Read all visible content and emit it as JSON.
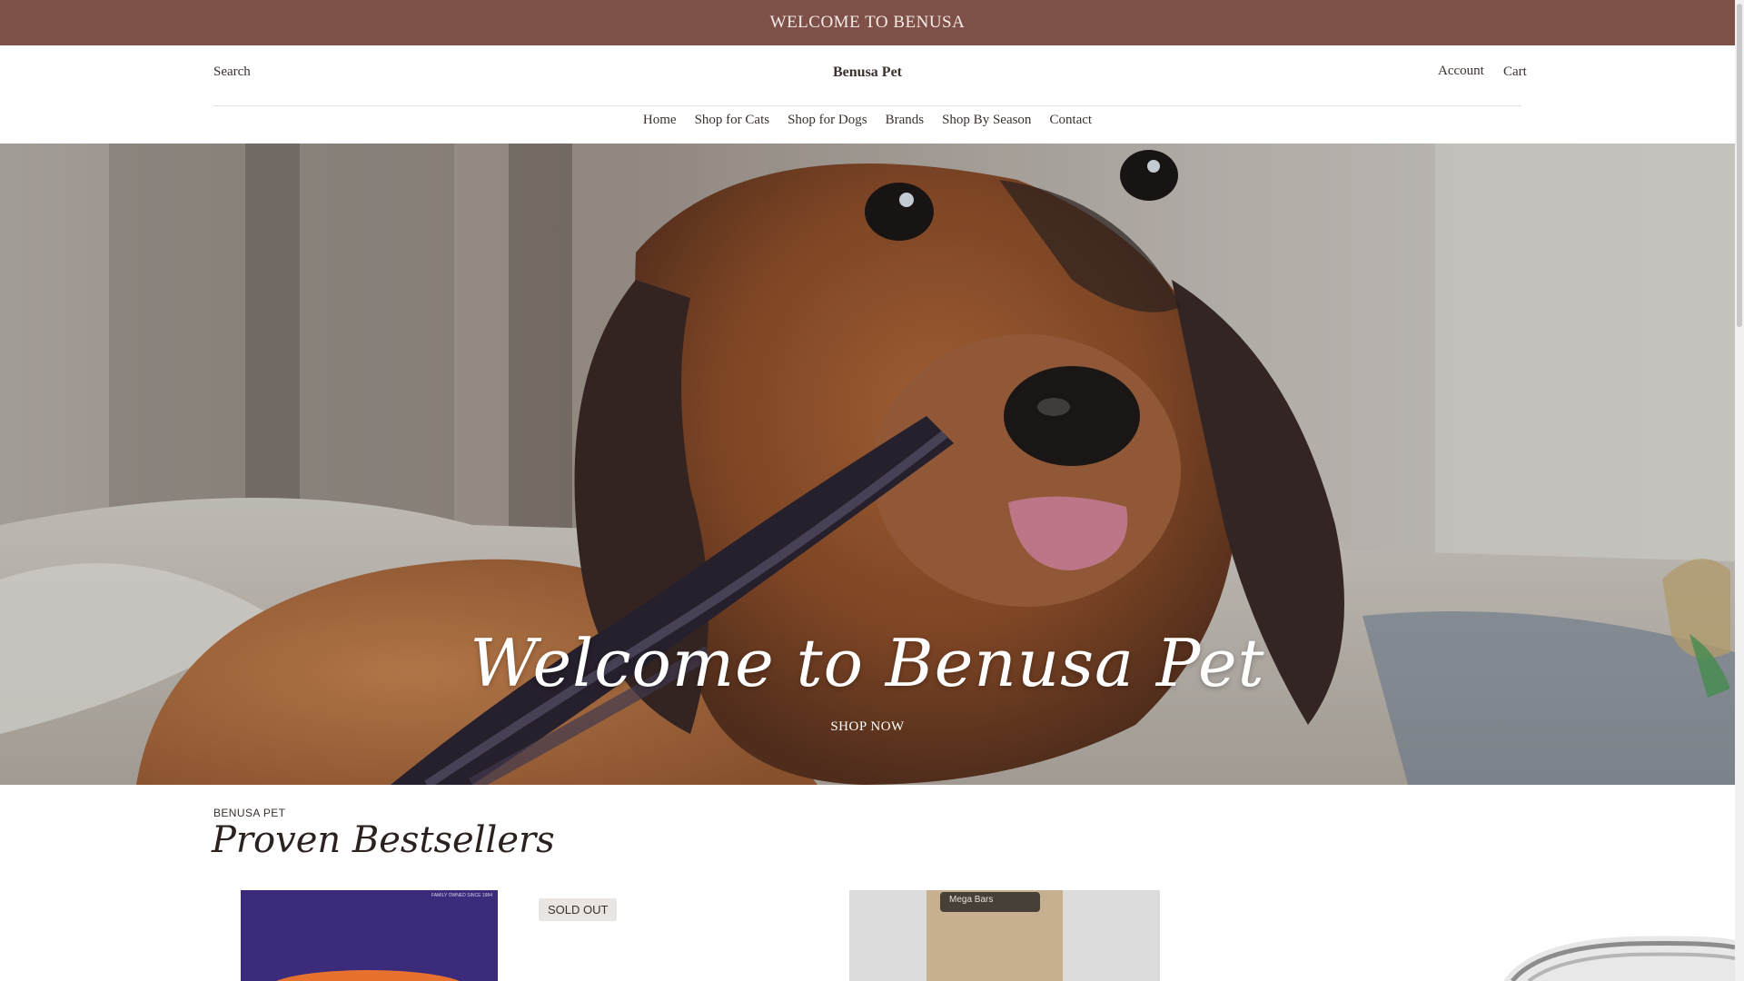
{
  "announcement": {
    "text": "WELCOME TO BENUSA"
  },
  "header": {
    "search_label": "Search",
    "logo": "Benusa Pet",
    "account_label": "Account",
    "cart_label": "Cart"
  },
  "nav": {
    "items": [
      {
        "label": "Home"
      },
      {
        "label": "Shop for Cats"
      },
      {
        "label": "Shop for Dogs"
      },
      {
        "label": "Brands"
      },
      {
        "label": "Shop By Season"
      },
      {
        "label": "Contact"
      }
    ]
  },
  "hero": {
    "title": "Welcome to Benusa Pet",
    "cta": "SHOP NOW"
  },
  "bestsellers": {
    "eyebrow": "BENUSA PET",
    "title": "Proven Bestsellers",
    "products": [
      {
        "badge": "",
        "package_text": "FAMILY OWNED SINCE 1984"
      },
      {
        "badge": "SOLD OUT"
      },
      {
        "badge": "",
        "package_text": "Mega Bars"
      },
      {
        "badge": ""
      }
    ]
  },
  "colors": {
    "announcement_bg": "#7e5048",
    "text": "#3a302d",
    "badge_bg": "#e9e5e2"
  }
}
